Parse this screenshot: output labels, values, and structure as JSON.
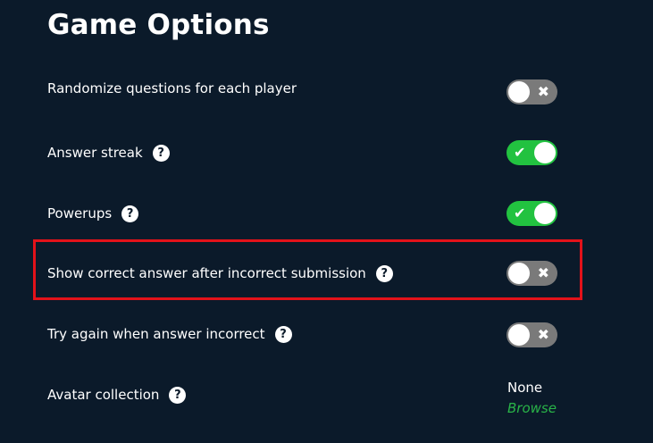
{
  "page": {
    "title": "Game Options"
  },
  "colors": {
    "background": "#0b1a2a",
    "toggle_on": "#22c240",
    "toggle_off": "#7a7a7a",
    "highlight": "#e3121a",
    "link": "#29b448"
  },
  "options": [
    {
      "label": "Randomize questions for each player",
      "has_help": false,
      "state": "off",
      "icon": "x-icon"
    },
    {
      "label": "Answer streak",
      "has_help": true,
      "state": "on",
      "icon": "check-icon"
    },
    {
      "label": "Powerups",
      "has_help": true,
      "state": "on",
      "icon": "check-icon"
    },
    {
      "label": "Show correct answer after incorrect submission",
      "has_help": true,
      "state": "off",
      "icon": "x-icon"
    },
    {
      "label": "Try again when answer incorrect",
      "has_help": true,
      "state": "off",
      "icon": "x-icon"
    }
  ],
  "avatar_collection": {
    "label": "Avatar collection",
    "value": "None",
    "browse_label": "Browse"
  },
  "glyphs": {
    "help": "?",
    "check": "✔",
    "x": "✖"
  }
}
